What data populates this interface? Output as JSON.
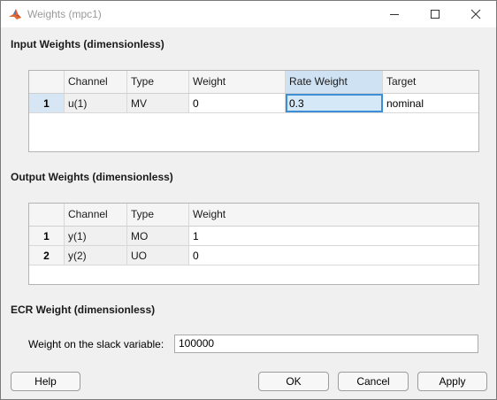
{
  "window": {
    "title": "Weights (mpc1)",
    "icons": [
      "matlab-app-icon",
      "minimize-icon",
      "maximize-icon",
      "close-icon"
    ]
  },
  "input_section": {
    "label": "Input Weights (dimensionless)",
    "columns": [
      "",
      "Channel",
      "Type",
      "Weight",
      "Rate Weight",
      "Target"
    ],
    "rows": [
      {
        "num": "1",
        "channel": "u(1)",
        "type": "MV",
        "weight": "0",
        "rate_weight": "0.3",
        "target": "nominal"
      }
    ]
  },
  "output_section": {
    "label": "Output Weights (dimensionless)",
    "columns": [
      "",
      "Channel",
      "Type",
      "Weight"
    ],
    "rows": [
      {
        "num": "1",
        "channel": "y(1)",
        "type": "MO",
        "weight": "1"
      },
      {
        "num": "2",
        "channel": "y(2)",
        "type": "UO",
        "weight": "0"
      }
    ]
  },
  "ecr_section": {
    "label": "ECR Weight (dimensionless)",
    "field_label": "Weight on the slack variable:",
    "value": "100000"
  },
  "buttons": {
    "help": "Help",
    "ok": "OK",
    "cancel": "Cancel",
    "apply": "Apply"
  },
  "colors": {
    "selection": "#d5e8f7",
    "focus_border": "#3c8fd6"
  }
}
